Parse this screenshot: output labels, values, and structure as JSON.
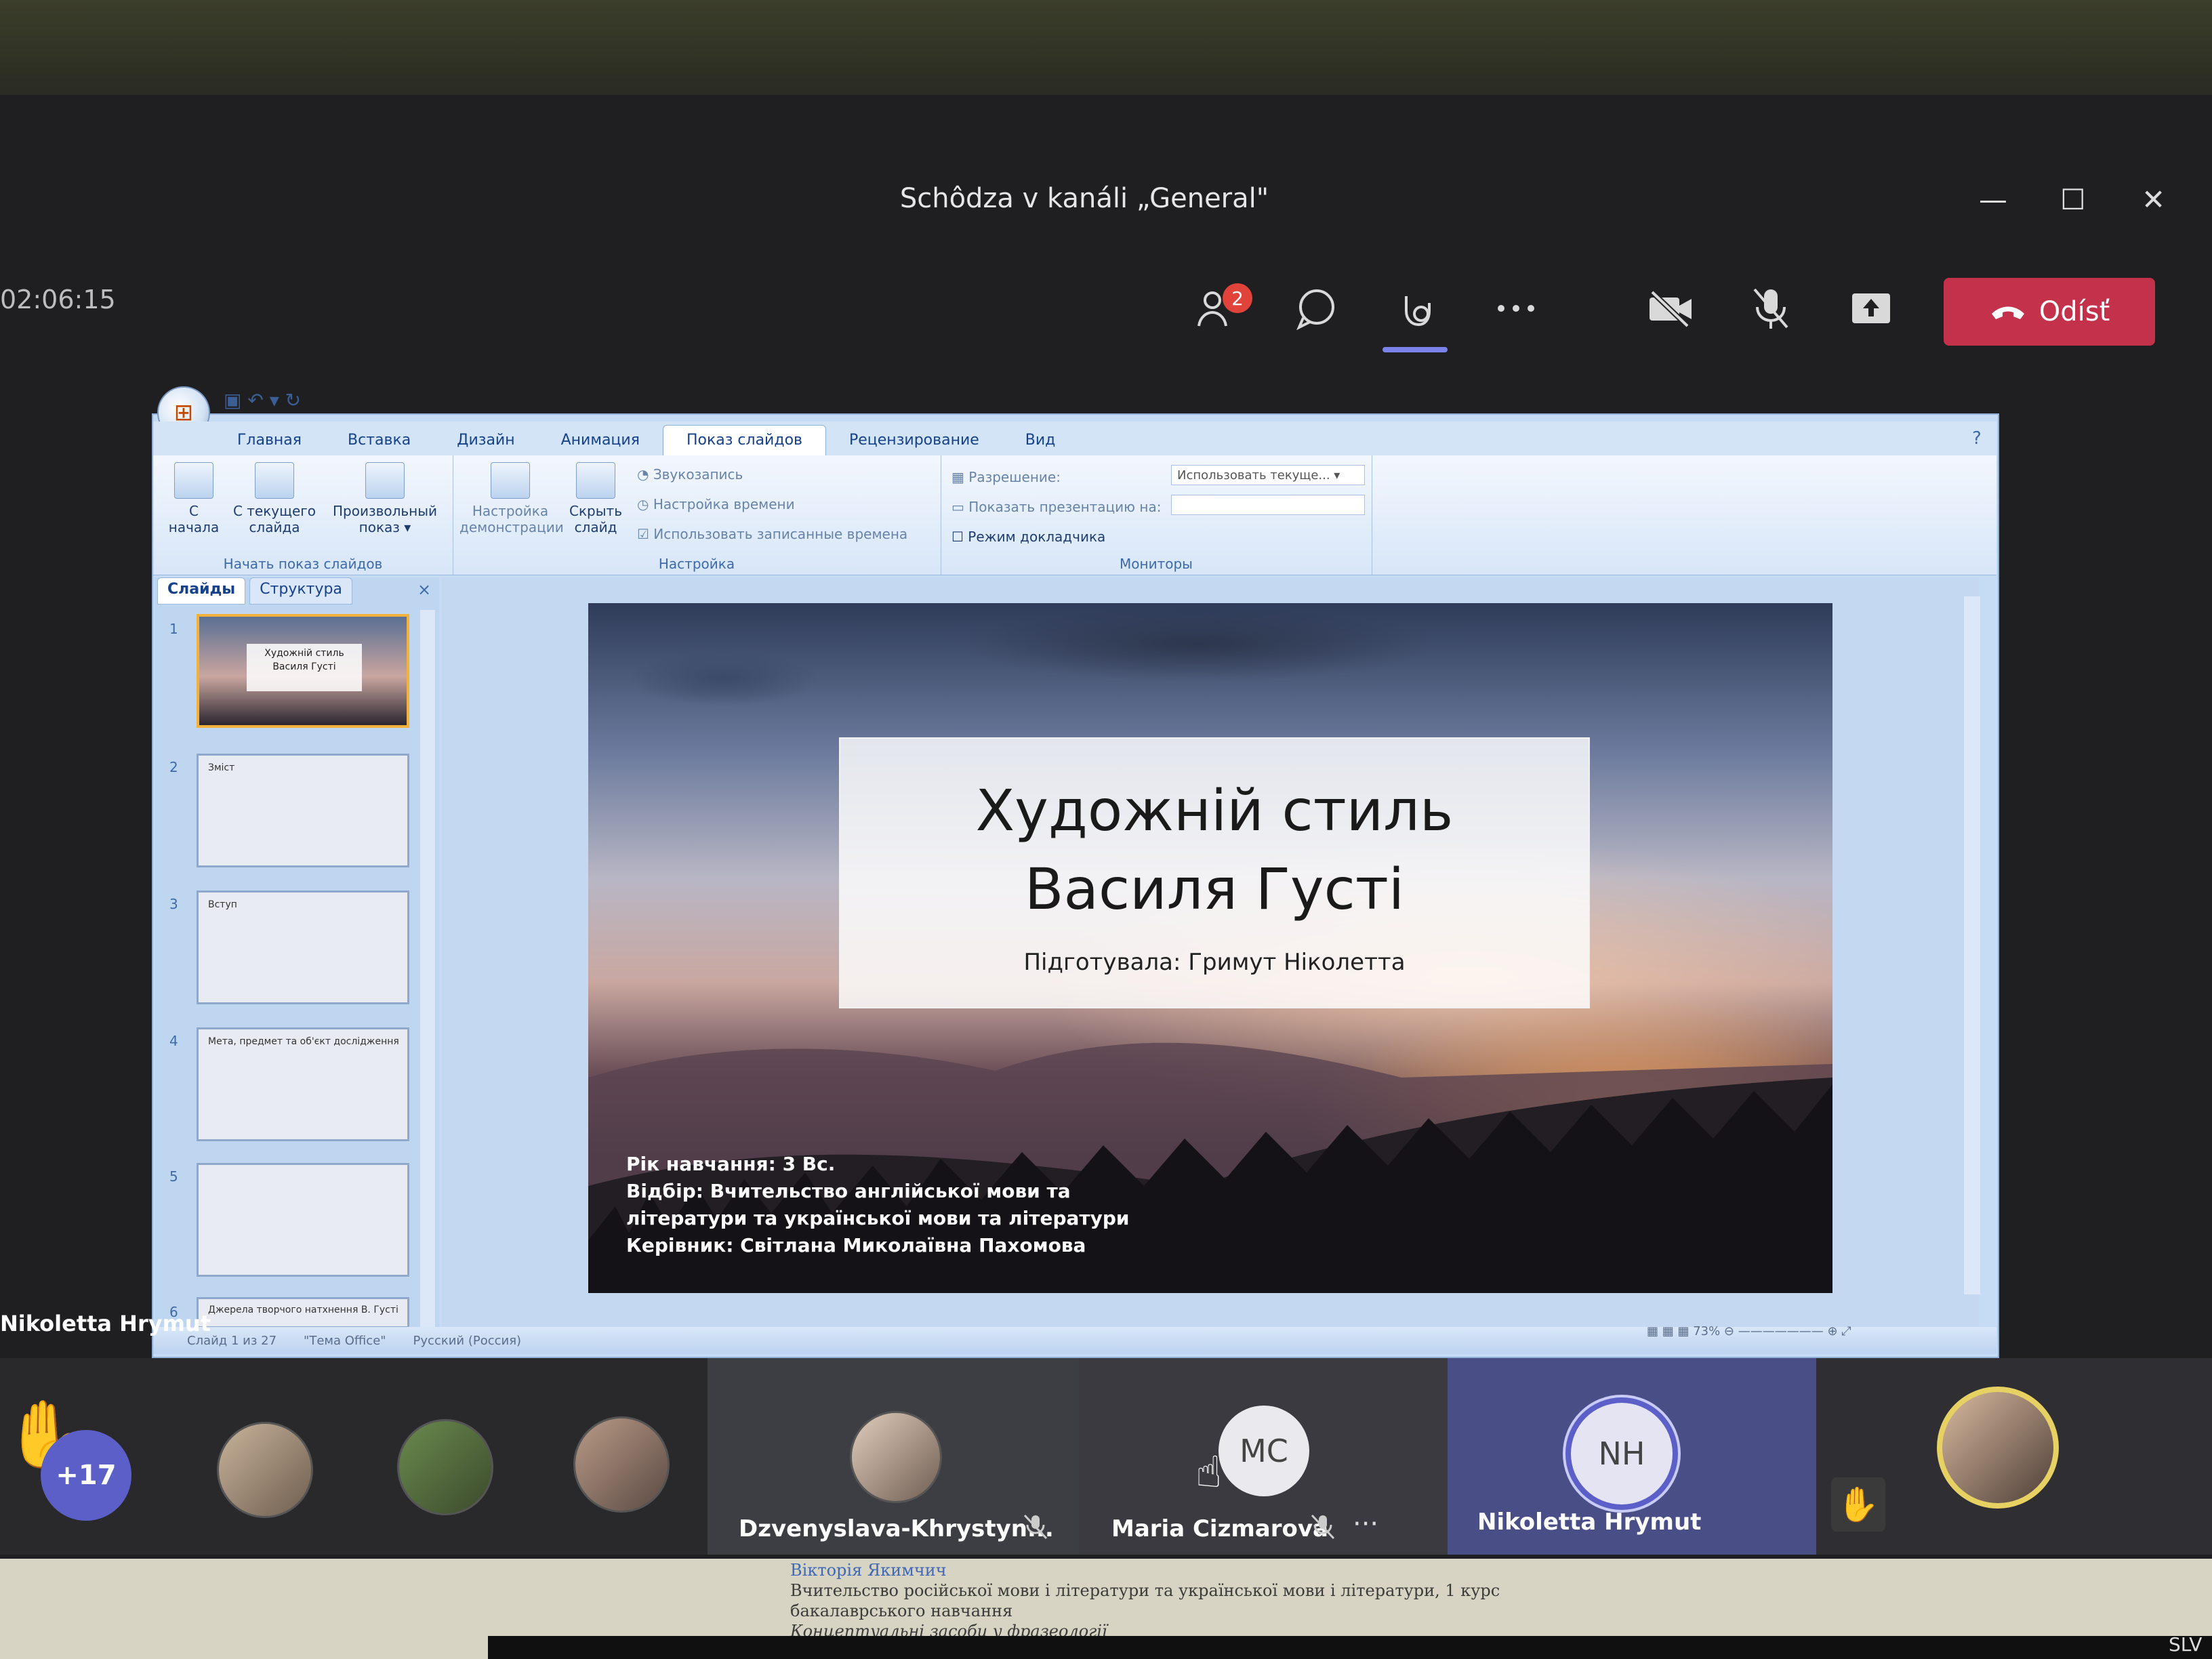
{
  "meeting": {
    "title": "Schôdza v kanáli „General\"",
    "timer": "02:06:15",
    "window_controls": {
      "minimize": "—",
      "maximize": "☐",
      "close": "✕"
    }
  },
  "toolbar": {
    "participants_badge": "2",
    "leave_label": "Odísť",
    "icons": [
      "people-icon",
      "chat-icon",
      "share-content-icon",
      "more-icon",
      "camera-off-icon",
      "mic-off-icon",
      "share-tray-icon",
      "phone-hangup-icon"
    ],
    "colors": {
      "leave": "#c4314b",
      "accent": "#7b83eb",
      "badge": "#e0433a"
    }
  },
  "ppt": {
    "tabs": [
      "Главная",
      "Вставка",
      "Дизайн",
      "Анимация",
      "Показ слайдов",
      "Рецензирование",
      "Вид"
    ],
    "active_tab": "Показ слайдов",
    "groups": {
      "start": {
        "label": "Начать показ слайдов",
        "buttons": [
          {
            "line1": "С",
            "line2": "начала"
          },
          {
            "line1": "С текущего",
            "line2": "слайда"
          },
          {
            "line1": "Произвольный",
            "line2": "показ ▾"
          }
        ]
      },
      "setup": {
        "label": "Настройка",
        "buttons": [
          {
            "line1": "Настройка",
            "line2": "демонстрации"
          },
          {
            "line1": "Скрыть",
            "line2": "слайд"
          }
        ],
        "rows": [
          "Звукозапись",
          "Настройка времени",
          "Использовать записанные времена"
        ]
      },
      "monitors": {
        "label": "Мониторы",
        "resolution_label": "Разрешение:",
        "resolution_value": "Использовать текуще...",
        "show_on_label": "Показать презентацию на:",
        "show_on_value": "",
        "presenter_view": "Режим докладчика"
      }
    },
    "pane_tabs": [
      "Слайды",
      "Структура"
    ],
    "pane_close": "×",
    "thumbnails": [
      {
        "num": "1",
        "text": "Художній стиль Василя Густі"
      },
      {
        "num": "2",
        "text": "Зміст"
      },
      {
        "num": "3",
        "text": "Вступ"
      },
      {
        "num": "4",
        "text": "Мета, предмет та об'єкт дослідження"
      },
      {
        "num": "5",
        "text": ""
      },
      {
        "num": "6",
        "text": "Джерела творчого натхнення В. Густі"
      }
    ],
    "slide": {
      "title_line1": "Художній стиль",
      "title_line2": "Василя Густі",
      "subtitle": "Підготувала: Гримут Ніколетта",
      "info": [
        "Рік навчання: 3 Вс.",
        "Відбір: Вчительство англійської мови та",
        "літератури  та української мови та літератури",
        "Керівник: Світлана Миколаївна Пахомова"
      ]
    },
    "status": {
      "slide_of": "Слайд 1 из 27",
      "theme": "\"Тема Office\"",
      "language": "Русский (Россия)",
      "zoom": "73%"
    }
  },
  "presenter": {
    "name": "Nikoletta Hrymut"
  },
  "participants": {
    "more_count": "+17",
    "tiles": [
      {
        "name": "Dzvenyslava-Khrystyn...",
        "muted": true
      },
      {
        "name": "Maria Cizmarova",
        "initials": "MC",
        "muted": true,
        "more": "···"
      },
      {
        "name": "Nikoletta Hrymut",
        "initials": "NH"
      }
    ]
  },
  "paper": {
    "name": "Вікторія Якимчич",
    "line1": "Вчительство російської мови і літератури та української мови і літератури, 1 курс",
    "line2": "бакалаврського навчання",
    "line3": "Концептуальні засоби у фразеології"
  },
  "tray": {
    "text": "SLV"
  }
}
